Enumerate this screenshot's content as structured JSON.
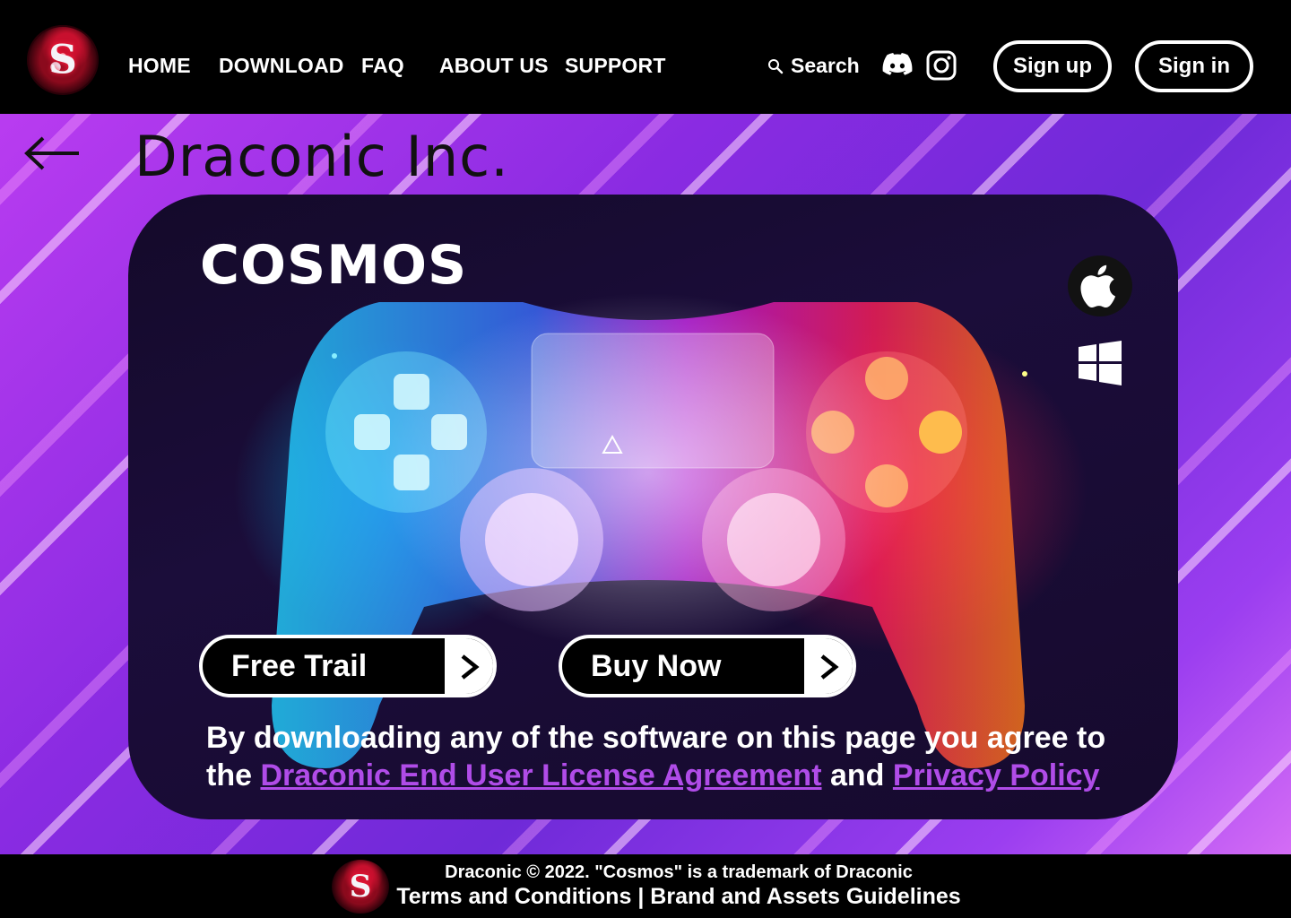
{
  "header": {
    "nav": [
      "HOME",
      "DOWNLOAD",
      "FAQ",
      "ABOUT US",
      "SUPPORT"
    ],
    "search_label": "Search",
    "signup_label": "Sign up",
    "signin_label": "Sign in"
  },
  "hero": {
    "brand": "Draconic Inc.",
    "product_title": "COSMOS",
    "free_trial_label": "Free Trail",
    "buy_now_label": "Buy Now",
    "legal_prefix": "By downloading any of the software on this page you agree to the",
    "eula_link": "Draconic End User License Agreement",
    "legal_and": "and",
    "privacy_link": "Privacy Policy",
    "platforms": [
      "apple-icon",
      "windows-icon"
    ]
  },
  "footer": {
    "copyright": "Draconic © 2022. \"Cosmos\" is a trademark of Draconic",
    "terms_link": "Terms and Conditions",
    "separator": "|",
    "brand_guidelines_link": "Brand and Assets Guidelines"
  },
  "colors": {
    "link_purple": "#b04ce8",
    "header_bg": "#000000",
    "bg_purple": "#7a2de0"
  }
}
